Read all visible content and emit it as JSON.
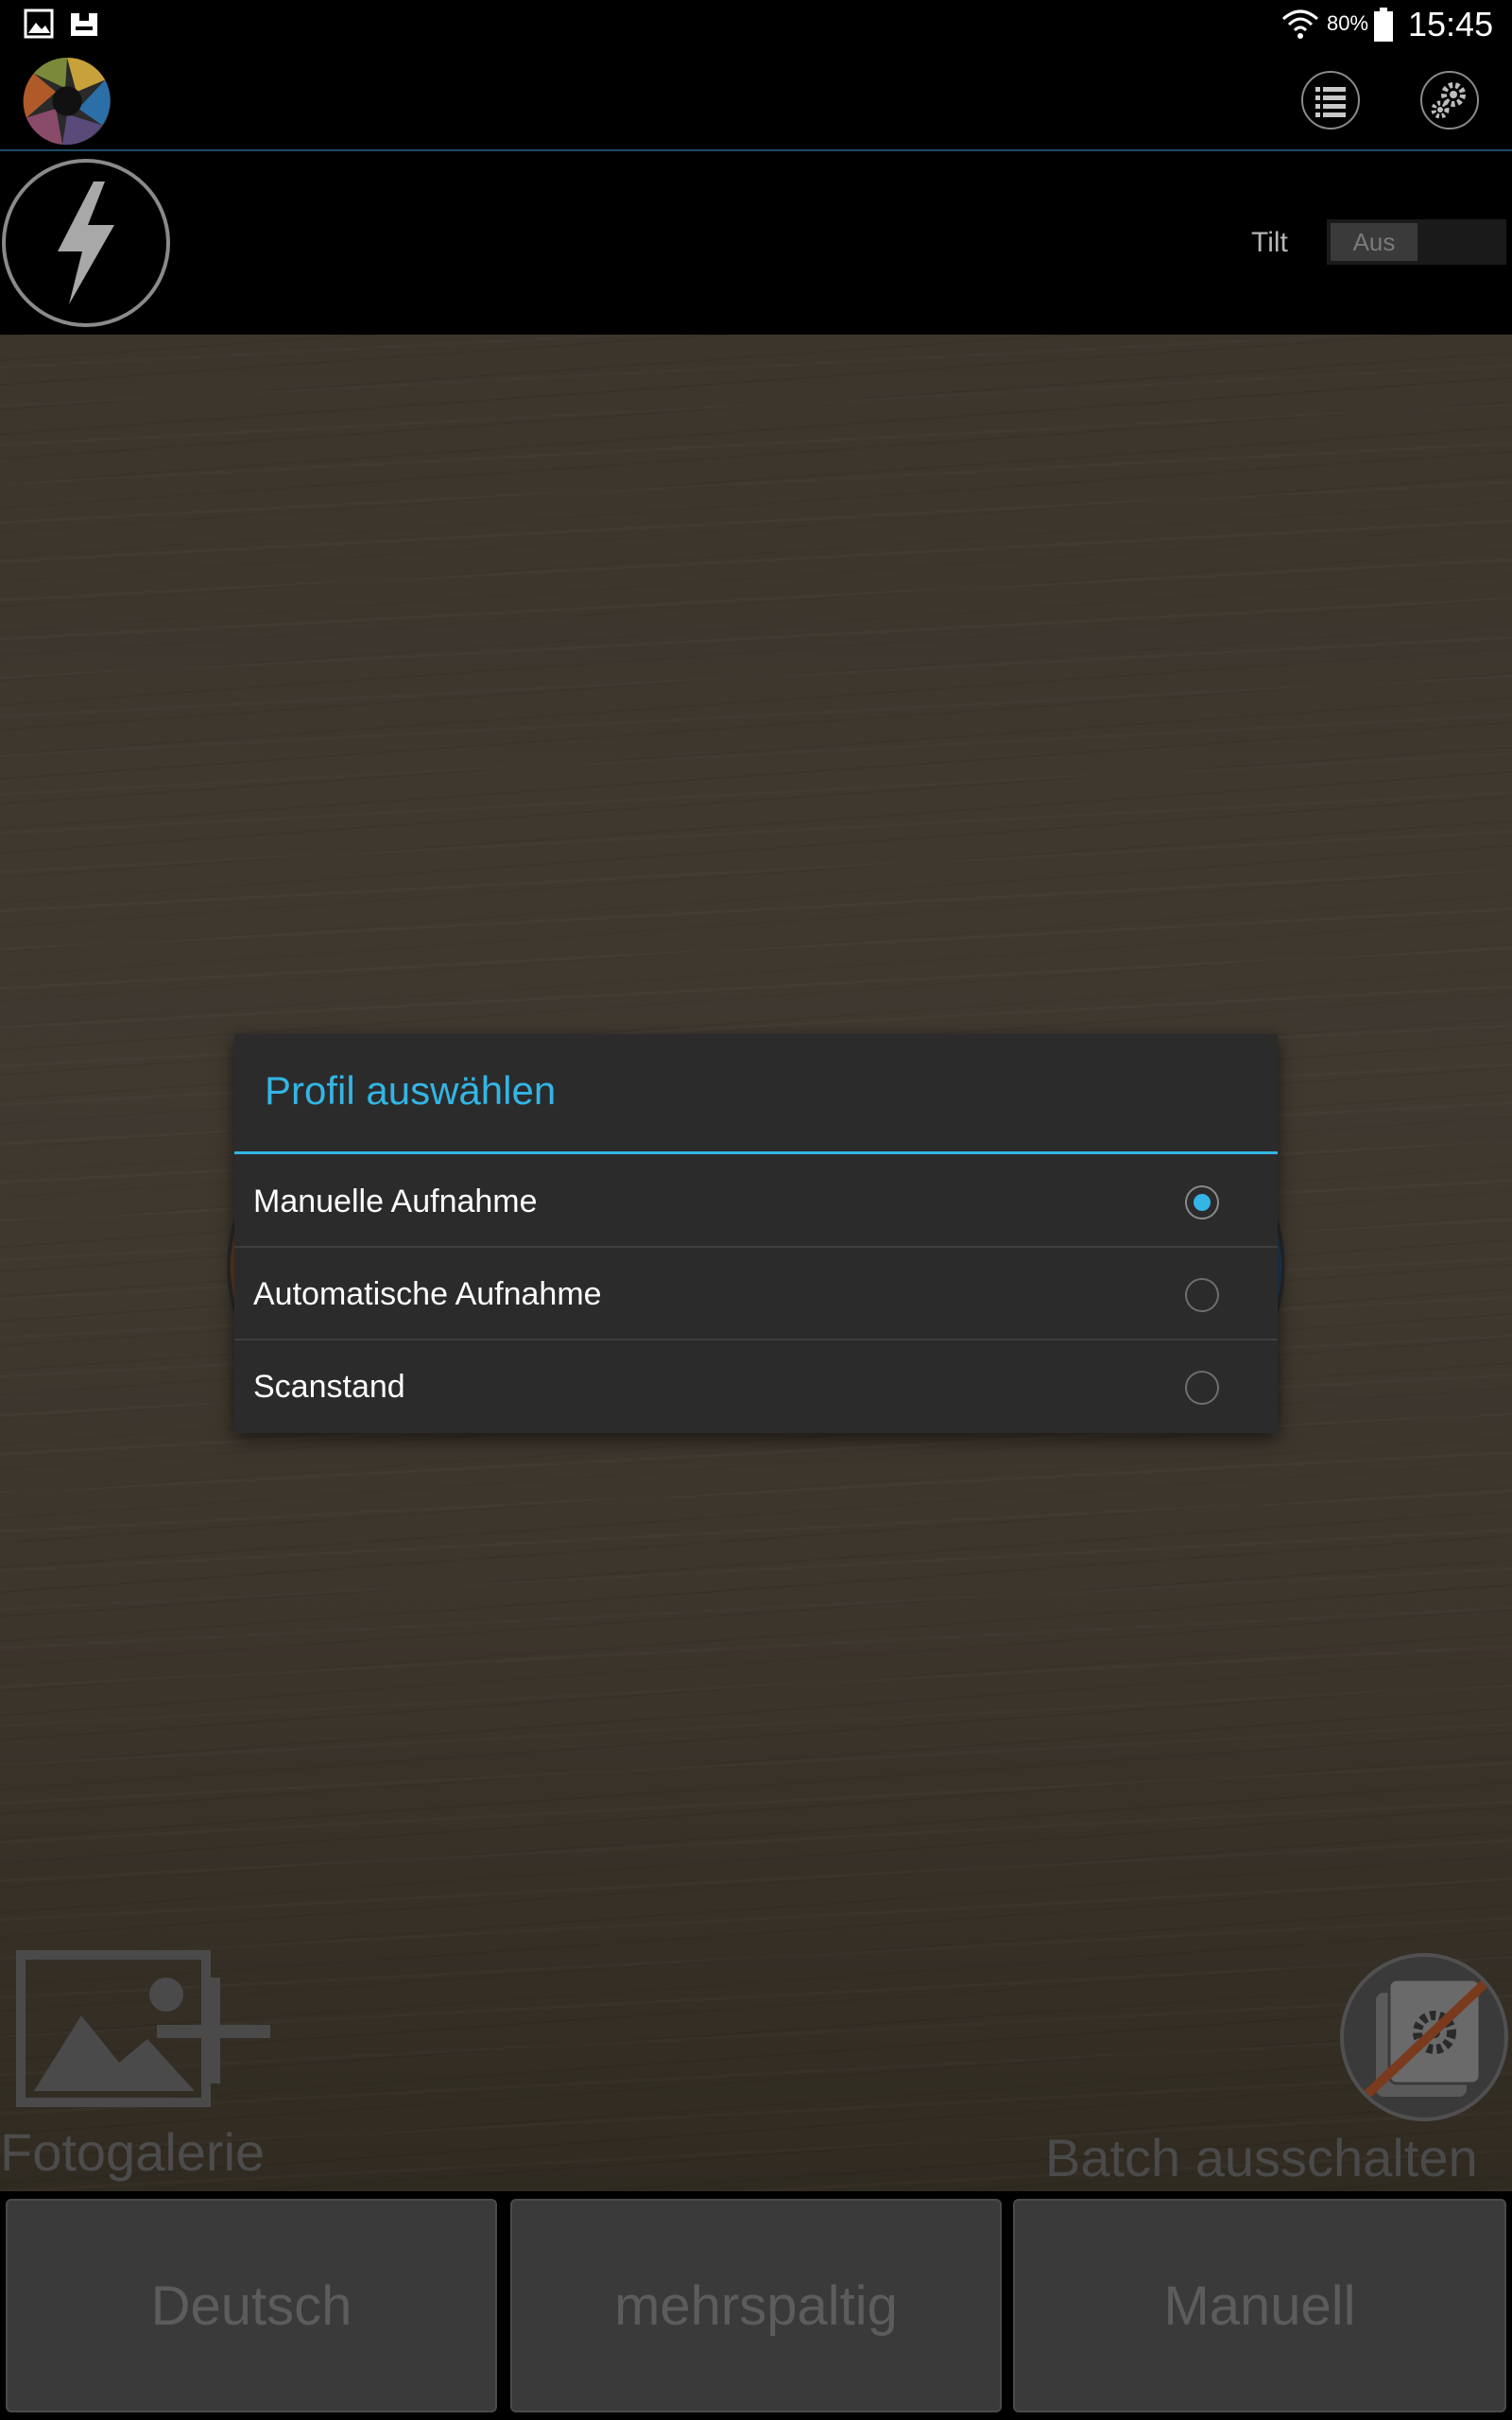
{
  "status_bar": {
    "notification_icons": [
      "gallery-icon",
      "download-icon"
    ],
    "wifi_icon": "wifi-icon",
    "battery_percent": "80%",
    "battery_icon": "battery-icon",
    "time": "15:45"
  },
  "action_bar": {
    "logo_icon": "camera-aperture-logo",
    "list_button_icon": "list-icon",
    "settings_button_icon": "gear-icon"
  },
  "toolbar": {
    "flash_icon": "lightning-icon",
    "tilt_label": "Tilt",
    "tilt_toggle_state": "Aus"
  },
  "preview": {
    "gallery_label": "Fotogalerie",
    "batch_label": "Batch ausschalten"
  },
  "dialog": {
    "title": "Profil auswählen",
    "options": [
      {
        "label": "Manuelle Aufnahme",
        "checked": true
      },
      {
        "label": "Automatische Aufnahme",
        "checked": false
      },
      {
        "label": "Scanstand",
        "checked": false
      }
    ]
  },
  "bottom_bar": {
    "language_button": "Deutsch",
    "layout_button": "mehrspaltig",
    "mode_button": "Manuell"
  },
  "colors": {
    "accent": "#33b5e5",
    "dialog_bg": "#2b2b2b",
    "button_bg": "#3a3a3a"
  }
}
